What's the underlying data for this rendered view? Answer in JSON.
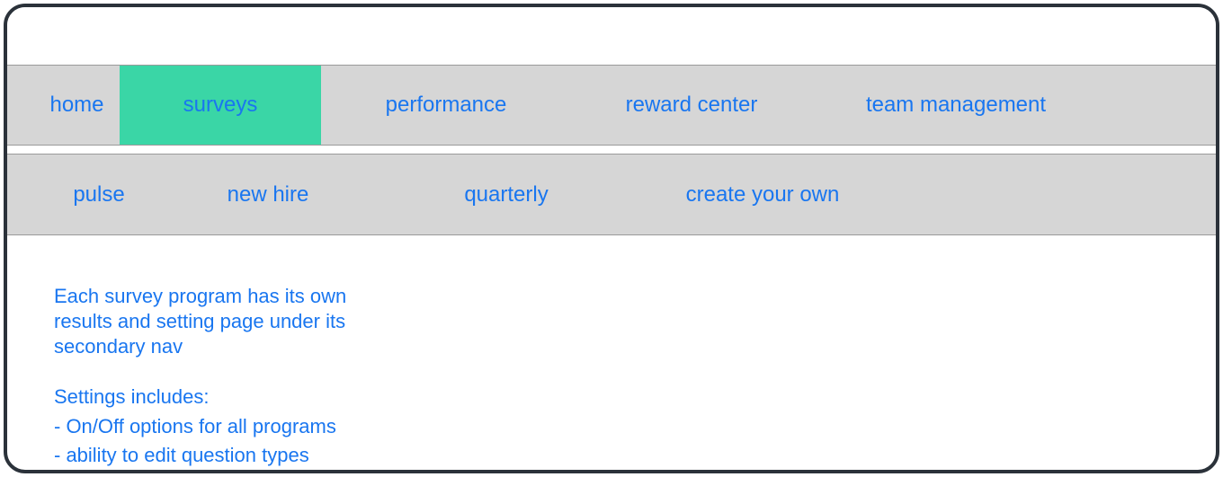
{
  "primary_nav": {
    "home": "home",
    "surveys": "surveys",
    "performance": "performance",
    "reward_center": "reward center",
    "team_management": "team management"
  },
  "secondary_nav": {
    "pulse": "pulse",
    "new_hire": "new hire",
    "quarterly": "quarterly",
    "create_your_own": "create your own"
  },
  "content": {
    "para1": "Each survey program has its own results and setting page under its secondary nav",
    "para2_heading": "Settings includes:",
    "bullet1": "- On/Off options for all programs",
    "bullet2": "- ability to edit question types"
  }
}
